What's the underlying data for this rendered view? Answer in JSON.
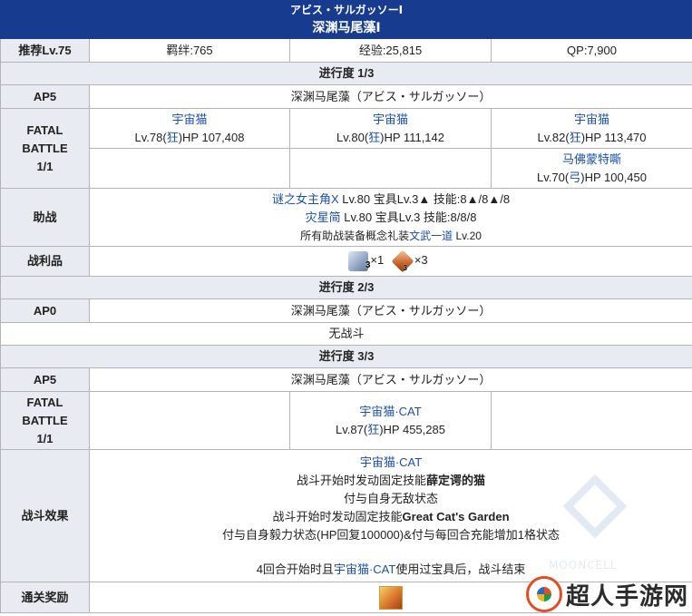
{
  "header": {
    "subtitle": "アビス・サルガッソーⅠ",
    "title": "深渊马尾藻Ⅰ"
  },
  "info": {
    "recommend": "推荐Lv.75",
    "bond": "羁绊:765",
    "exp": "经验:25,815",
    "qp": "QP:7,900"
  },
  "progress1": {
    "label": "进行度 1/3",
    "ap": "AP5",
    "location": "深渊马尾藻（アビス・サルガッソー）",
    "battle_label": [
      "FATAL",
      "BATTLE",
      "1/1"
    ],
    "enemies_row1": [
      {
        "name": "宇宙猫",
        "lv_pre": "Lv.78(",
        "cls": "狂",
        "lv_post": ")HP 107,408"
      },
      {
        "name": "宇宙猫",
        "lv_pre": "Lv.80(",
        "cls": "狂",
        "lv_post": ")HP 111,142"
      },
      {
        "name": "宇宙猫",
        "lv_pre": "Lv.82(",
        "cls": "狂",
        "lv_post": ")HP 113,470"
      }
    ],
    "enemy_row2": {
      "name": "马佛蒙特嘶",
      "lv_pre": "Lv.70(",
      "cls": "弓",
      "lv_post": ")HP 100,450"
    },
    "support_label": "助战",
    "support": [
      {
        "name": "谜之女主角X",
        "detail": " Lv.80 宝具Lv.3▲ 技能:8▲/8▲/8"
      },
      {
        "name": "灾星简",
        "detail": " Lv.80 宝具Lv.3 技能:8/8/8"
      }
    ],
    "support_note_pre": "所有助战装备概念礼装",
    "support_note_link": "文武一道",
    "support_note_post": " Lv.20",
    "drops_label": "战利品",
    "drops": [
      {
        "icon": "ice-material-icon",
        "badge": "3",
        "count": "×1"
      },
      {
        "icon": "flame-material-icon",
        "badge": "3",
        "count": "×3"
      }
    ]
  },
  "progress2": {
    "label": "进行度 2/3",
    "ap": "AP0",
    "location": "深渊马尾藻（アビス・サルガッソー）",
    "no_battle": "无战斗"
  },
  "progress3": {
    "label": "进行度 3/3",
    "ap": "AP5",
    "location": "深渊马尾藻（アビス・サルガッソー）",
    "battle_label": [
      "FATAL",
      "BATTLE",
      "1/1"
    ],
    "enemy": {
      "name": "宇宙猫·CAT",
      "lv_pre": "Lv.87(",
      "cls": "狂",
      "lv_post": ")HP 455,285"
    },
    "effects_label": "战斗效果",
    "effects": {
      "enemy_link": "宇宙猫·CAT",
      "line1_pre": "战斗开始时发动固定技能",
      "line1_bold": "薛定谔的猫",
      "line2": "付与自身无敌状态",
      "line3_pre": "战斗开始时发动固定技能",
      "line3_bold": "Great Cat's Garden",
      "line4": "付与自身毅力状态(HP回复100000)&付与每回合充能增加1格状态",
      "line5_pre": "4回合开始时且",
      "line5_link": "宇宙猫·CAT",
      "line5_post": "使用过宝具后，战斗结束"
    },
    "reward_label": "通关奖励"
  },
  "watermark": {
    "text": "MOONCELL"
  },
  "branding": {
    "name": "超人手游网"
  }
}
